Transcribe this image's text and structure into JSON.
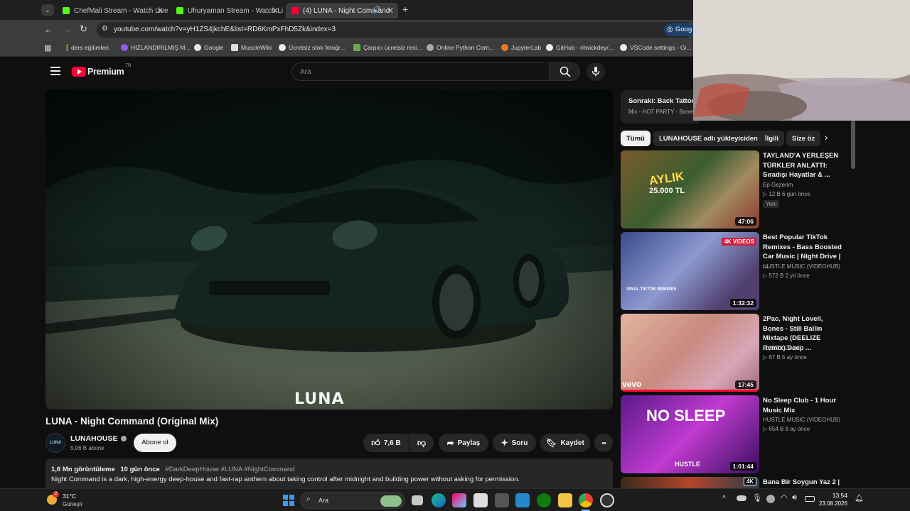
{
  "browser": {
    "tabs": [
      {
        "title": "ChefMali Stream - Watch Live o",
        "active": false
      },
      {
        "title": "Uhuryaman Stream - Watch Live",
        "active": false
      },
      {
        "title": "(4) LUNA - Night Command",
        "active": true
      }
    ],
    "new_tab": "+",
    "url": "youtube.com/watch?v=yH1ZS4jkchE&list=RD6KmPxFhD5Zk&index=3",
    "side_button": "Goog",
    "bookmarks": [
      "ders eğitimleri",
      "HIZLANDIRILMIŞ M...",
      "Google",
      "MuscleWiki",
      "Ücretsiz stok fotoğr...",
      "Çarpıcı ücretsiz resi...",
      "Online Python Com...",
      "JupyterLab",
      "GitHub - ritwickdey/...",
      "VSCode settings - Gi..."
    ]
  },
  "youtube": {
    "logo_text": "Premium",
    "logo_region": "TR",
    "search_placeholder": "Ara"
  },
  "video": {
    "overlay_logo": "LUNA",
    "title": "LUNA - Night Command (Original Mix)",
    "channel": "LUNAHOUSE",
    "subscribers": "5,06 B abone",
    "subscribe_label": "Abone ol",
    "likes": "7,6 B",
    "share_label": "Paylaş",
    "ask_label": "Soru",
    "save_label": "Kaydet",
    "more_label": "•••",
    "views": "1,6 Mn görüntüleme",
    "date": "10 gün önce",
    "hashtags": "#DarkDeepHouse #LUNA #NightCommand",
    "description": "Night Command is a dark, high-energy deep-house and fast-rap anthem about taking control after midnight and building power without asking for permission."
  },
  "next_up": {
    "label": "Sonraki: Back Tattoo",
    "sub": "Mix - HOT PARTY - Bones"
  },
  "chips": [
    "Tümü",
    "LUNAHOUSE adlı yükleyiciden",
    "İlgili",
    "Size öz"
  ],
  "related": [
    {
      "title": "TAYLAND'A YERLEŞEN TÜRKLER ANLATTI: Sıradışı Hayatlar & ...",
      "channel": "Ep Gezerim",
      "meta": "▷ 12 B   6 gün önce",
      "badge": "Yeni",
      "duration": "47:06",
      "thumb_text": "AYLIK",
      "thumb_text2": "25.000 TL"
    },
    {
      "title": "Best Popular TikTok Remixes - Bass Boosted Car Music | Night Drive | ...",
      "channel": "HUSTLE MUSIC (VIDEOHUB)",
      "meta": "▷ 572 B   2 yıl önce",
      "duration": "1:32:32",
      "thumb_text": "4K VIDEOS",
      "thumb_text2": "VIRAL TIKTOK REMIXES"
    },
    {
      "title": "2Pac, Night Lovell, Bones - Still Ballin Mixtape (DEELIZE Remix) Deep ...",
      "channel": "DYSSO GANG",
      "meta": "▷ 67 B   5 ay önce",
      "duration": "17:45",
      "thumb_text": "vevo"
    },
    {
      "title": "No Sleep Club - 1 Hour Music Mix",
      "channel": "HUSTLE MUSIC (VIDEOHUB)",
      "meta": "▷ 654 B   8 ay önce",
      "duration": "1:01:44",
      "thumb_text": "NO SLEEP",
      "thumb_text2": "HUSTLE"
    },
    {
      "title": "Bana Bir Soygun Yaz 2 |",
      "thumb_text": "4K"
    }
  ],
  "taskbar": {
    "weather_temp": "31°C",
    "weather_desc": "Güneşli",
    "weather_badge": "2",
    "search_label": "Ara",
    "time": "13:54",
    "date": "23.08.2026"
  },
  "colors": {
    "yt_red": "#ff0033",
    "bg": "#0f0f0f",
    "chip_bg": "#272727"
  }
}
